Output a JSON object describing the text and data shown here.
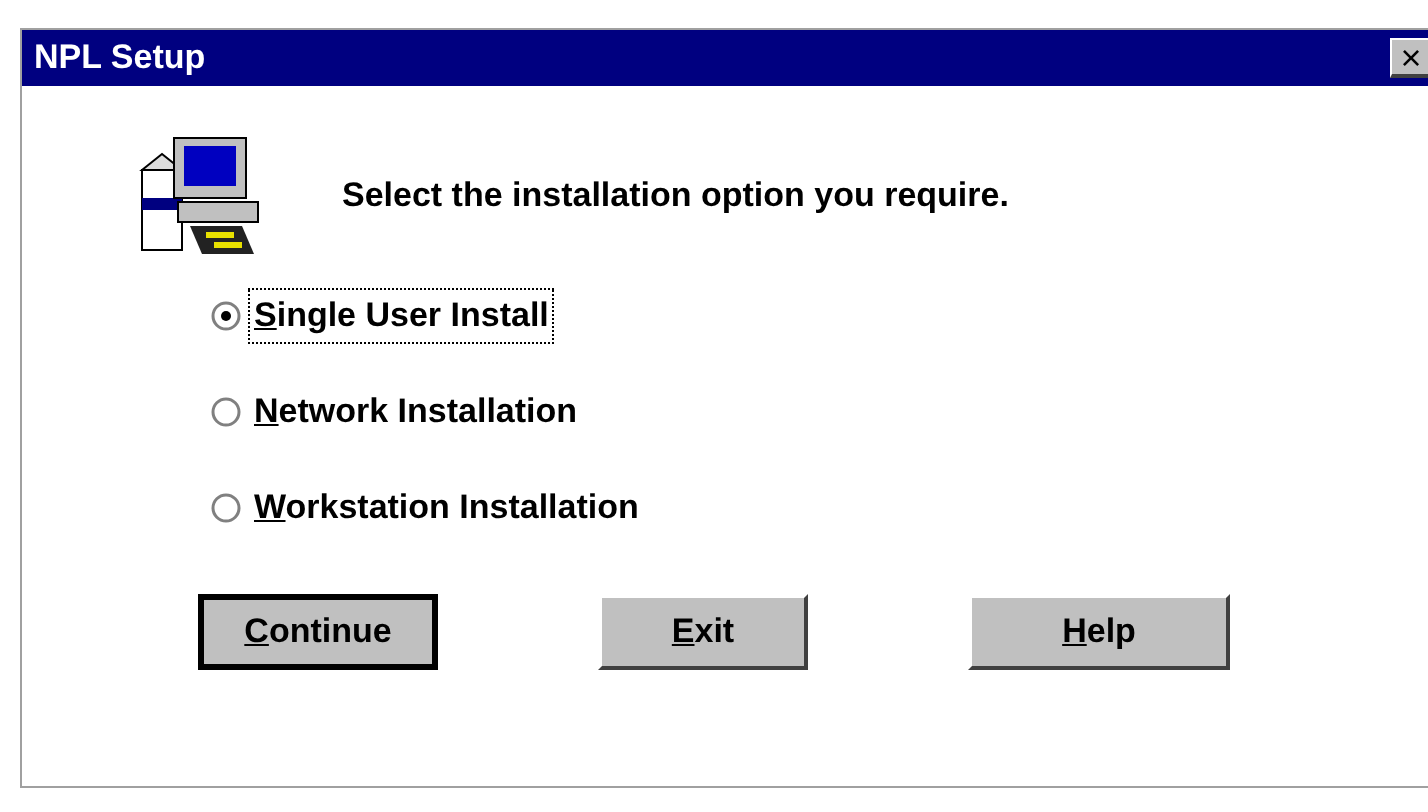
{
  "window": {
    "title": "NPL Setup",
    "close": "×"
  },
  "prompt": "Select the installation option you require.",
  "options": [
    {
      "label": "Single User Install",
      "selected": true
    },
    {
      "label": "Network Installation",
      "selected": false
    },
    {
      "label": "Workstation Installation",
      "selected": false
    }
  ],
  "buttons": [
    {
      "label": "Continue",
      "default": true
    },
    {
      "label": "Exit",
      "default": false
    },
    {
      "label": "Help",
      "default": false
    }
  ]
}
